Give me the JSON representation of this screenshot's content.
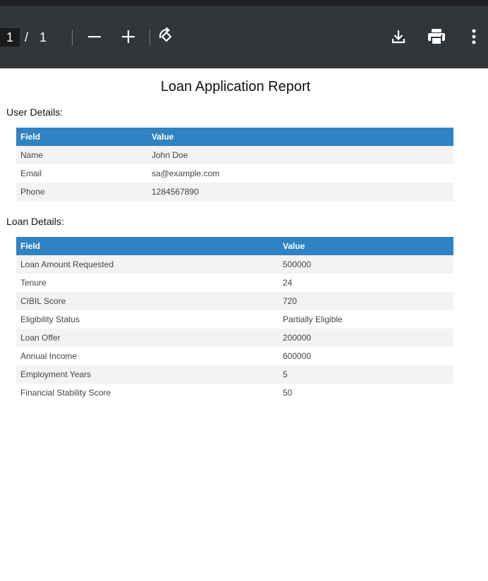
{
  "toolbar": {
    "current_page": "1",
    "separator": "/",
    "total_pages": "1",
    "icons": [
      "zoom-out-icon",
      "zoom-in-icon",
      "rotate-icon",
      "download-icon",
      "print-icon",
      "more-vert-icon"
    ]
  },
  "report": {
    "title": "Loan Application Report",
    "user_section": {
      "heading": "User Details:",
      "col_field": "Field",
      "col_value": "Value",
      "rows": [
        {
          "field": "Name",
          "value": "John Doe"
        },
        {
          "field": "Email",
          "value": "sa@example.com"
        },
        {
          "field": "Phone",
          "value": "1284567890"
        }
      ]
    },
    "loan_section": {
      "heading": "Loan Details:",
      "col_field": "Field",
      "col_value": "Value",
      "rows": [
        {
          "field": "Loan Amount Requested",
          "value": "500000"
        },
        {
          "field": "Tenure",
          "value": "24"
        },
        {
          "field": "CIBIL Score",
          "value": "720"
        },
        {
          "field": "Eligibility Status",
          "value": "Partially Eligible"
        },
        {
          "field": "Loan Offer",
          "value": "200000"
        },
        {
          "field": "Annual Income",
          "value": "600000"
        },
        {
          "field": "Employment Years",
          "value": "5"
        },
        {
          "field": "Financial Stability Score",
          "value": "50"
        }
      ]
    }
  },
  "colors": {
    "toolbar_bg": "#323639",
    "table_header": "#2f83c2",
    "row_stripe": "#f3f3f3"
  }
}
